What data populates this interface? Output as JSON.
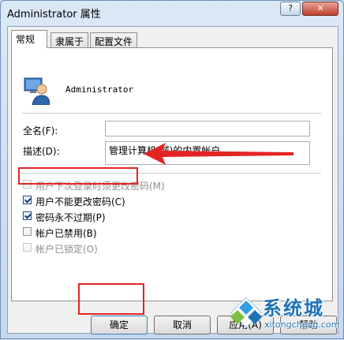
{
  "window": {
    "title": "Administrator 属性",
    "help_button": "?",
    "close_button": "✕"
  },
  "tabs": [
    {
      "label": "常规",
      "active": true
    },
    {
      "label": "隶属于",
      "active": false
    },
    {
      "label": "配置文件",
      "active": false
    }
  ],
  "user": {
    "name": "Administrator",
    "icon": "user-account-icon"
  },
  "fields": {
    "fullname_label": "全名(F):",
    "fullname_value": "",
    "description_label": "描述(D):",
    "description_value": "管理计算机(域)的内置帐户"
  },
  "checkboxes": [
    {
      "label": "用户下次登录时须更改密码(M)",
      "checked": false,
      "disabled": true
    },
    {
      "label": "用户不能更改密码(C)",
      "checked": true,
      "disabled": false
    },
    {
      "label": "密码永不过期(P)",
      "checked": true,
      "disabled": false
    },
    {
      "label": "帐户已禁用(B)",
      "checked": false,
      "disabled": false
    },
    {
      "label": "帐户已锁定(O)",
      "checked": false,
      "disabled": true
    }
  ],
  "buttons": {
    "ok": "确定",
    "cancel": "取消",
    "apply": "应用(A)",
    "help": "帮助"
  },
  "annotation": {
    "highlight_color": "#e32424"
  },
  "watermark": {
    "brand": "系统城",
    "url": "xitongcheng.com"
  }
}
